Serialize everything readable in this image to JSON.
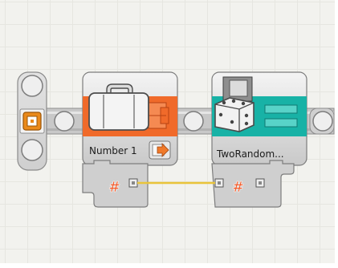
{
  "blocks": [
    {
      "label": "Number 1",
      "category": "variable",
      "icon": "suitcase-icon",
      "accent": "#f06a2a",
      "action_icon": "arrow-right-icon"
    },
    {
      "label": "TwoRandom...",
      "category": "random",
      "icon": "dice-icon",
      "accent": "#18b2a6"
    }
  ],
  "data_plugs": {
    "symbol": "#",
    "wire_color": "#e9c43a"
  },
  "start_block": {
    "icon": "start-icon",
    "color": "#ea8a1b"
  }
}
